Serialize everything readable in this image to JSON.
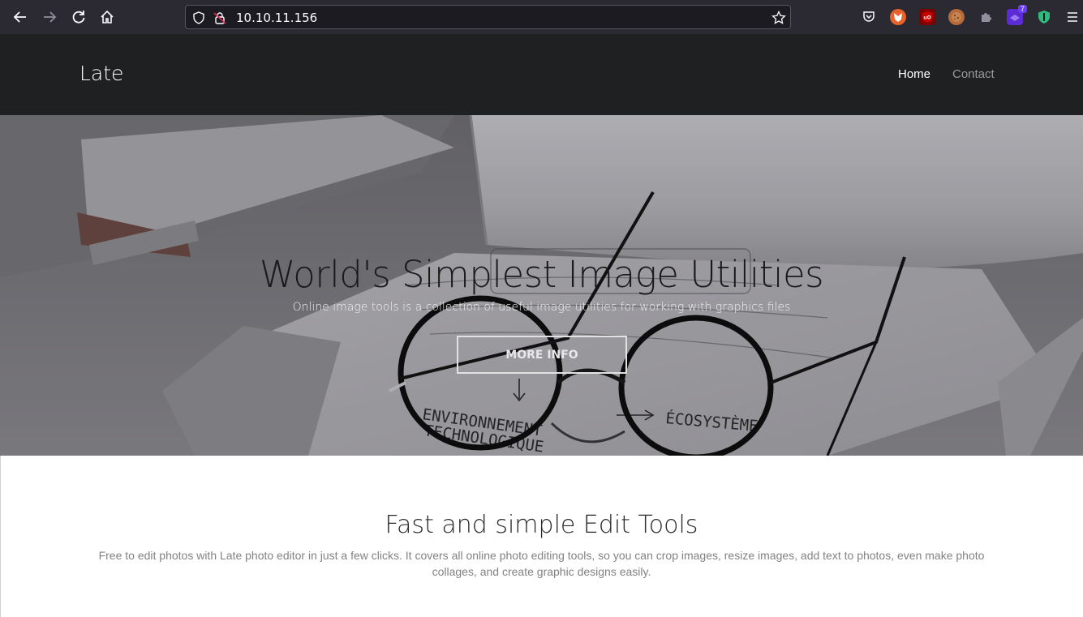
{
  "browser": {
    "url": "10.10.11.156",
    "extension_badge": "7"
  },
  "header": {
    "brand": "Late",
    "nav": {
      "home": "Home",
      "contact": "Contact"
    }
  },
  "hero": {
    "title": "World's Simplest Image Utilities",
    "subtitle": "Online image tools is a collection of useful image utilities for working with graphics files",
    "button": "MORE INFO"
  },
  "section": {
    "title": "Fast and simple Edit Tools",
    "text": "Free to edit photos with Late photo editor in just a few clicks. It covers all online photo editing tools, so you can crop images, resize images, add text to photos, even make photo collages, and create graphic designs easily."
  },
  "photo_handwriting": {
    "env": "ENVIRONNEMENT",
    "tech": "TECHNOLOGIQUE",
    "eco": "ÉCOSYSTÈME"
  }
}
